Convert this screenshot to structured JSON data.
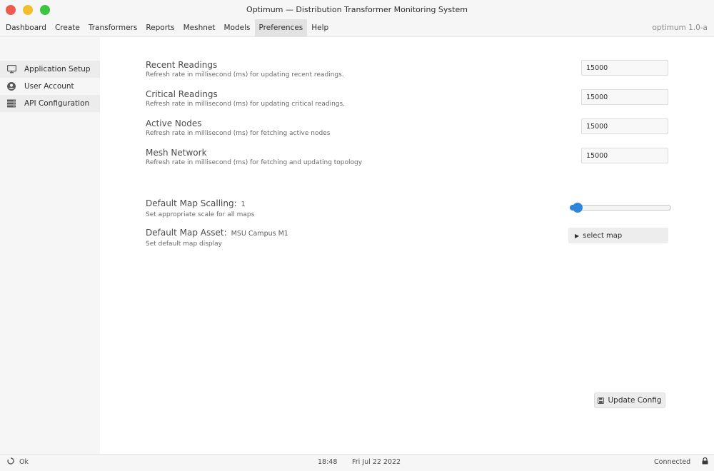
{
  "window": {
    "title": "Optimum — Distribution Transformer Monitoring System",
    "controls": [
      "close",
      "minimize",
      "maximize"
    ]
  },
  "menubar": {
    "items": [
      {
        "label": "Dashboard",
        "active": false
      },
      {
        "label": "Create",
        "active": false
      },
      {
        "label": "Transformers",
        "active": false
      },
      {
        "label": "Reports",
        "active": false
      },
      {
        "label": "Meshnet",
        "active": false
      },
      {
        "label": "Models",
        "active": false
      },
      {
        "label": "Preferences",
        "active": true
      },
      {
        "label": "Help",
        "active": false
      }
    ],
    "version": "optimum 1.0-a"
  },
  "sidebar": {
    "items": [
      {
        "label": "Application Setup",
        "icon": "monitor-icon"
      },
      {
        "label": "User Account",
        "icon": "user-circle-icon"
      },
      {
        "label": "API Configuration",
        "icon": "server-icon"
      }
    ]
  },
  "settings": {
    "recent": {
      "title": "Recent Readings",
      "desc": "Refresh rate in millisecond (ms) for updating recent readings.",
      "value": "15000"
    },
    "critical": {
      "title": "Critical Readings",
      "desc": "Refresh rate in millisecond (ms) for updating critical readings.",
      "value": "15000"
    },
    "active": {
      "title": "Active Nodes",
      "desc": "Refresh rate in millisecond (ms) for fetching active nodes",
      "value": "15000"
    },
    "mesh": {
      "title": "Mesh Network",
      "desc": "Refresh rate in millisecond (ms) for fetching and updating topology",
      "value": "15000"
    },
    "scaling": {
      "title": "Default Map Scalling:",
      "value": "1",
      "desc": "Set appropriate scale for all maps",
      "slider_fraction": 0.03
    },
    "asset": {
      "title": "Default Map Asset:",
      "value": "MSU Campus M1",
      "desc": "Set default map display",
      "button_label": "select map"
    }
  },
  "actions": {
    "update_label": "Update Config"
  },
  "statusbar": {
    "status": "Ok",
    "time": "18:48",
    "date": "Fri Jul 22 2022",
    "connection": "Connected"
  },
  "colors": {
    "accent": "#2f86dd",
    "close": "#ee5b4f",
    "minimize": "#f3be2c",
    "maximize": "#3cc541"
  }
}
